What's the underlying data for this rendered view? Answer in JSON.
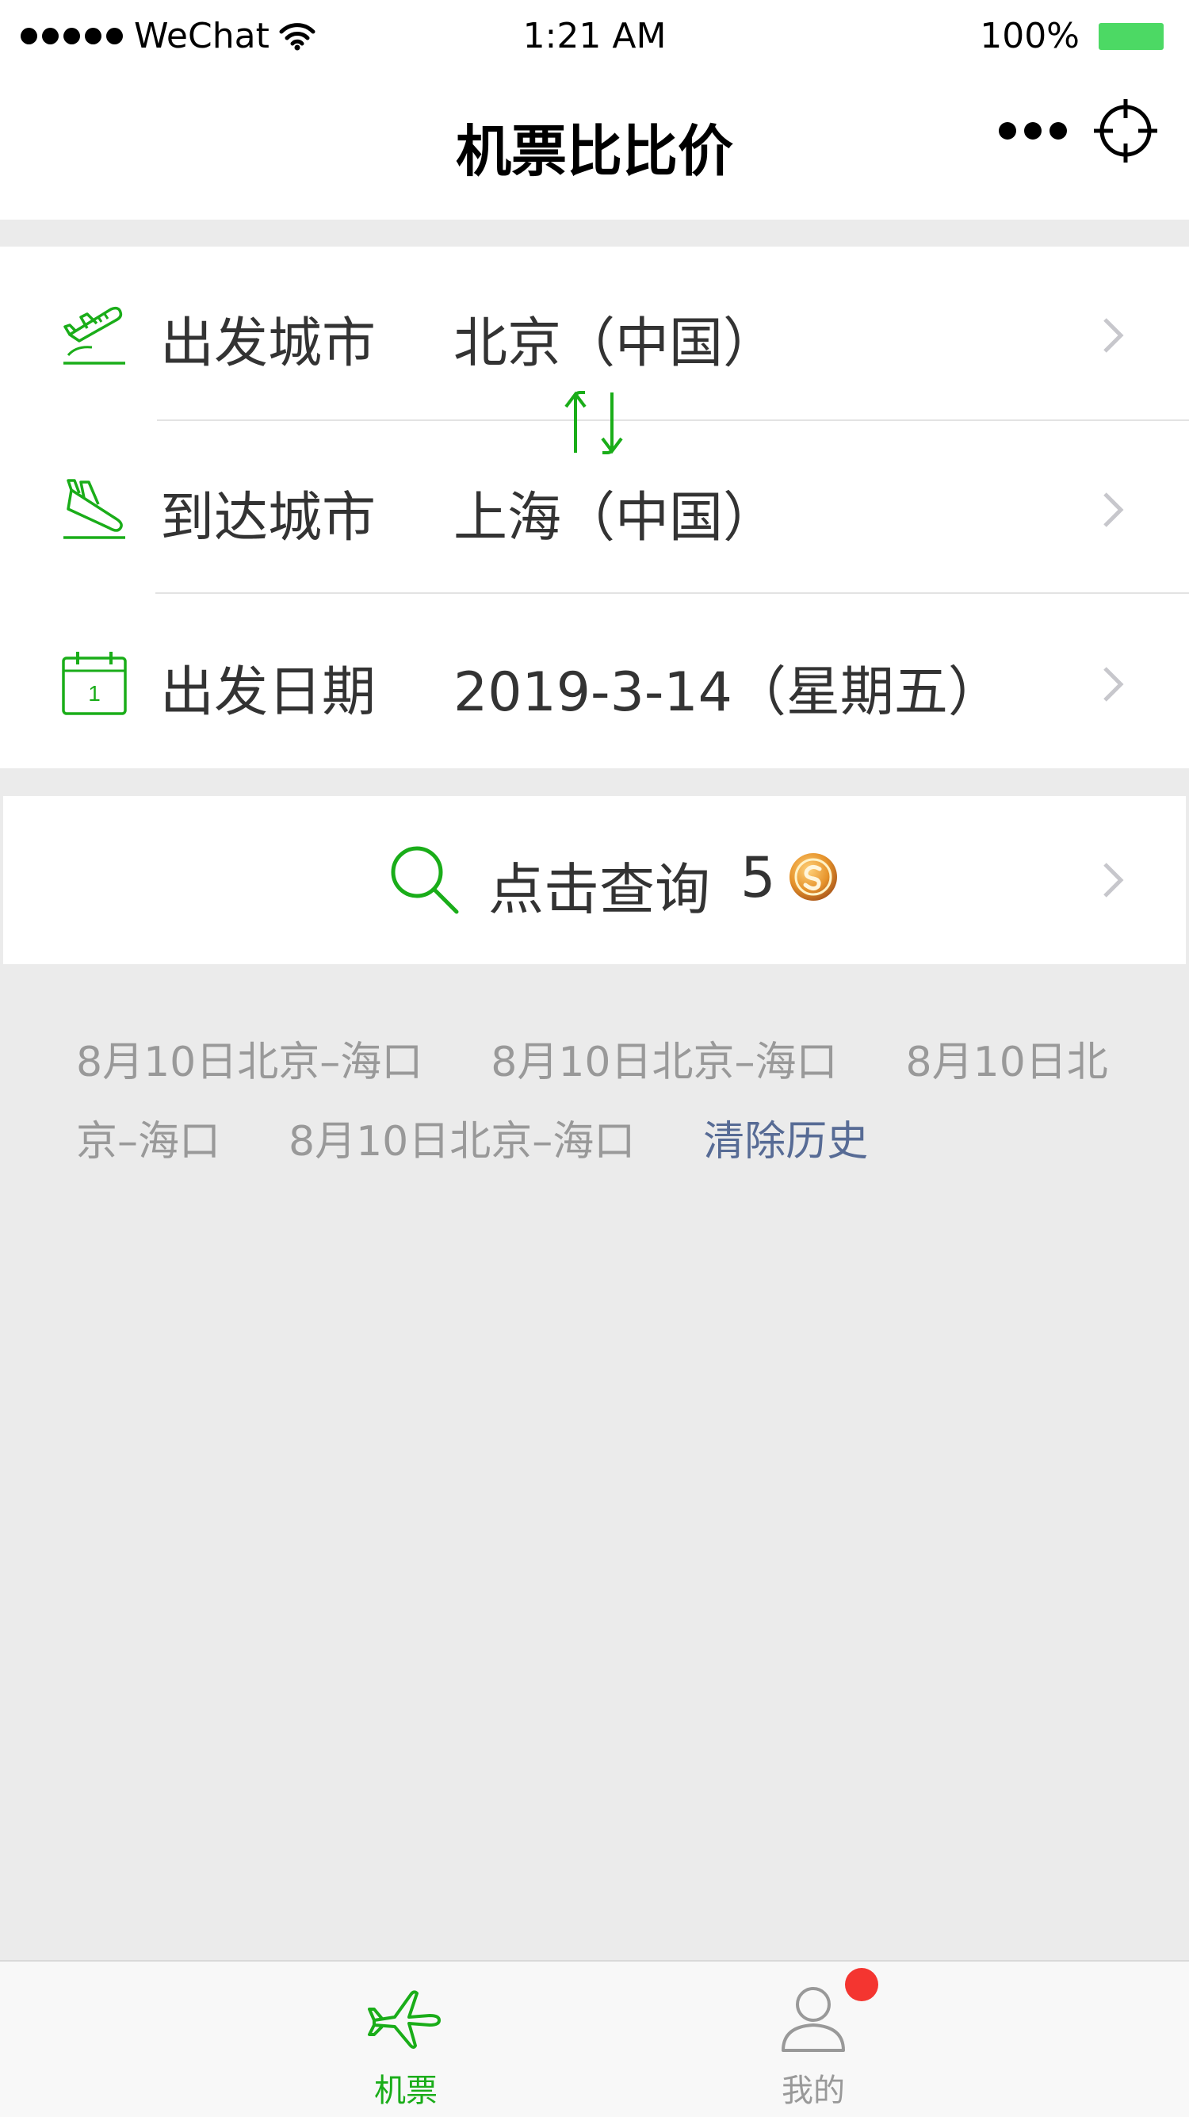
{
  "status_bar": {
    "carrier": "WeChat",
    "time": "1:21 AM",
    "battery": "100%"
  },
  "navbar": {
    "title": "机票比比价"
  },
  "form": {
    "departure": {
      "label": "出发城市",
      "value": "北京（中国）",
      "icon": "airplane-takeoff-icon"
    },
    "arrival": {
      "label": "到达城市",
      "value": "上海（中国）",
      "icon": "airplane-landing-icon"
    },
    "date": {
      "label": "出发日期",
      "value": "2019-3-14（星期五）",
      "icon": "calendar-icon",
      "icon_day": "1"
    }
  },
  "query": {
    "label": "点击查询",
    "count": "5"
  },
  "history": {
    "items": [
      "8月10日北京–海口",
      "8月10日北京–海口",
      "8月10日北京–海口",
      "8月10日北京–海口"
    ],
    "clear_label": "清除历史"
  },
  "tabbar": {
    "tabs": [
      {
        "label": "机票",
        "icon": "airplane-icon",
        "active": true
      },
      {
        "label": "我的",
        "icon": "user-icon",
        "active": false,
        "badge": true
      }
    ]
  },
  "colors": {
    "accent": "#1aad19",
    "link": "#576b95",
    "badge": "#f43530",
    "battery": "#4cd964"
  }
}
